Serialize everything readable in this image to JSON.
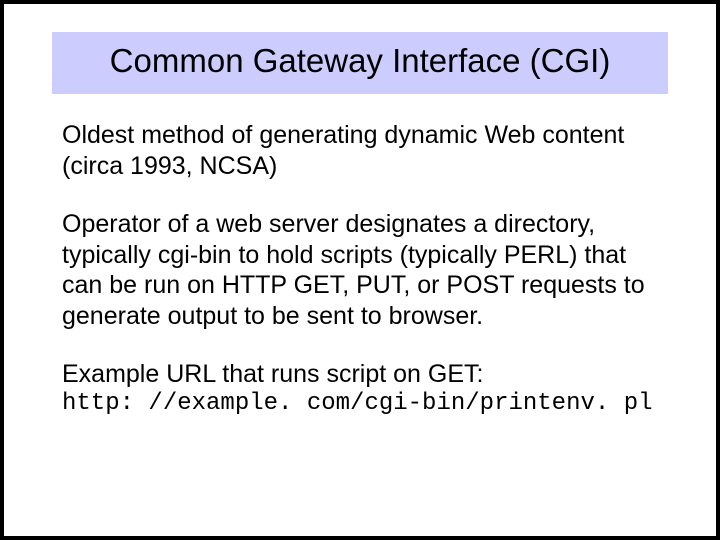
{
  "title": "Common Gateway Interface (CGI)",
  "para1": "Oldest method of generating dynamic Web content (circa 1993, NCSA)",
  "para2": "Operator of a web server designates a directory, typically cgi-bin to hold scripts (typically PERL) that can be run on HTTP GET, PUT, or POST requests to generate output to be sent to browser.",
  "para3": "Example URL that runs script on GET:",
  "example_url": "http: //example. com/cgi-bin/printenv. pl"
}
